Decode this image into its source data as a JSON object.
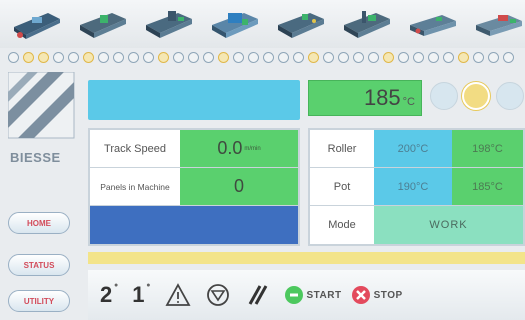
{
  "header": {
    "machine_icons": [
      "machine-module-1-icon",
      "machine-module-2-icon",
      "machine-module-3-icon",
      "machine-module-4-icon",
      "machine-module-5-icon",
      "machine-module-6-icon",
      "machine-module-7-icon",
      "machine-module-8-icon"
    ]
  },
  "logo": {
    "text": "BIESSE"
  },
  "sidebar": {
    "home_label": "HOME",
    "status_label": "STATUS",
    "utility_label": "UTILITY"
  },
  "temperature": {
    "value": "185",
    "unit": "°C"
  },
  "left_table": {
    "track_speed_label": "Track Speed",
    "track_speed_value": "0.0",
    "track_speed_unit": "m/min",
    "panels_label": "Panels in Machine",
    "panels_value": "0"
  },
  "right_table": {
    "roller_label": "Roller",
    "roller_set": "200°C",
    "roller_actual": "198°C",
    "pot_label": "Pot",
    "pot_set": "190°C",
    "pot_actual": "185°C",
    "mode_label": "Mode",
    "mode_value": "WORK"
  },
  "toolbar": {
    "btn_2": "2",
    "btn_1": "1",
    "start_label": "START",
    "stop_label": "STOP"
  },
  "colors": {
    "cyan": "#5bc9e8",
    "green": "#5ad06e",
    "blue": "#3e6fc0",
    "yellow": "#f3e48a",
    "start": "#4cc85e",
    "stop": "#e34a5d"
  }
}
